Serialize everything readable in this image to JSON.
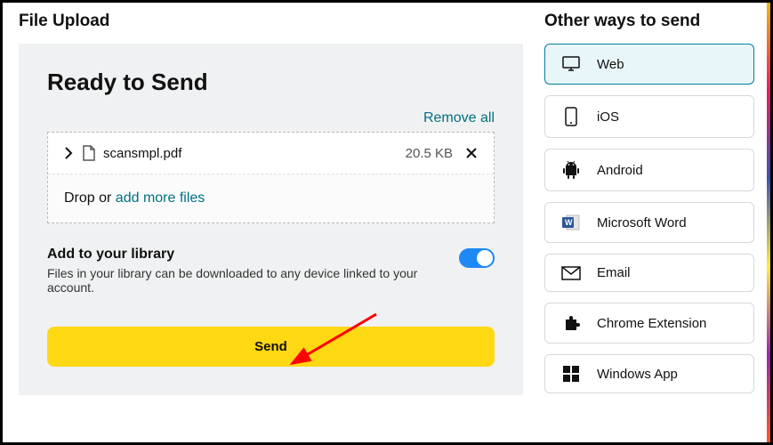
{
  "left": {
    "section_title": "File Upload",
    "panel_title": "Ready to Send",
    "remove_all": "Remove all",
    "file": {
      "name": "scansmpl.pdf",
      "size": "20.5 KB"
    },
    "drop_prefix": "Drop or ",
    "drop_link": "add more files",
    "library": {
      "title": "Add to your library",
      "desc": "Files in your library can be downloaded to any device linked to your account.",
      "toggle_on": true
    },
    "send_label": "Send"
  },
  "right": {
    "section_title": "Other ways to send",
    "options": {
      "web": "Web",
      "ios": "iOS",
      "android": "Android",
      "word": "Microsoft Word",
      "email": "Email",
      "chrome": "Chrome Extension",
      "windows": "Windows App"
    }
  }
}
